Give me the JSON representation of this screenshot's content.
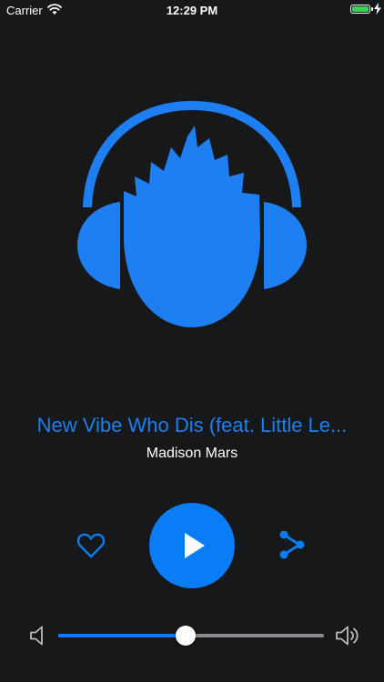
{
  "status_bar": {
    "carrier": "Carrier",
    "time": "12:29 PM",
    "wifi_icon": "wifi-icon",
    "battery_icon": "battery-icon",
    "battery_level": 1.0,
    "battery_color": "#37d058"
  },
  "artwork": {
    "icon": "headphones-icon",
    "color": "#1e7ff3"
  },
  "track": {
    "title": "New Vibe Who Dis (feat. Little Le...",
    "artist": "Madison Mars"
  },
  "controls": {
    "like_icon": "heart-icon",
    "play_icon": "play-icon",
    "share_icon": "share-icon",
    "accent_color": "#0a7cf5"
  },
  "volume": {
    "level": 0.48,
    "low_icon": "volume-low-icon",
    "high_icon": "volume-high-icon"
  }
}
